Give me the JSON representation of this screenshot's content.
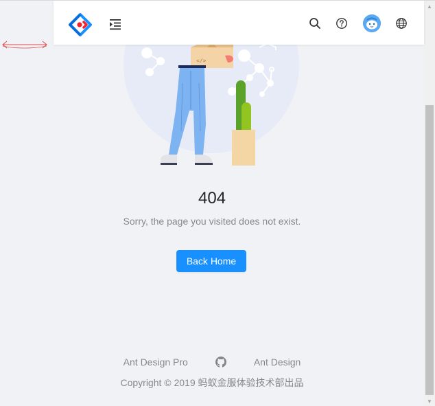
{
  "header": {
    "logo": "ant-design-pro-logo",
    "menu_toggle": "menu-unfold-icon",
    "actions": [
      "search-icon",
      "question-circle-icon",
      "avatar",
      "global-icon"
    ]
  },
  "result": {
    "title": "404",
    "subtitle": "Sorry, the page you visited does not exist.",
    "button_label": "Back Home"
  },
  "footer": {
    "links": [
      "Ant Design Pro",
      "github-icon",
      "Ant Design"
    ],
    "link_pro": "Ant Design Pro",
    "link_ant": "Ant Design",
    "copyright": "Copyright © 2019 蚂蚁金服体验技术部出品"
  },
  "colors": {
    "primary": "#1890ff",
    "background": "#f0f2f5",
    "logo_blue": "#1890ff",
    "logo_red": "#f5222d"
  }
}
